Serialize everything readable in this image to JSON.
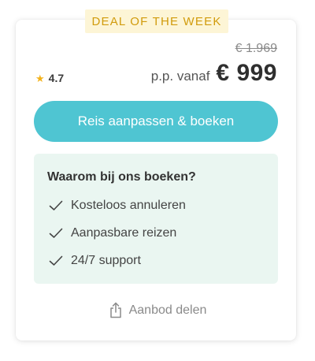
{
  "deal": {
    "badge": "DEAL OF THE WEEK"
  },
  "rating": {
    "value": "4.7",
    "icon": "star-icon"
  },
  "price": {
    "old": "€ 1.969",
    "prefix": "p.p. vanaf",
    "current": "€ 999"
  },
  "cta": {
    "label": "Reis aanpassen & boeken"
  },
  "why": {
    "title": "Waarom bij ons boeken?",
    "benefits": [
      {
        "label": "Kosteloos annuleren"
      },
      {
        "label": "Aanpasbare reizen"
      },
      {
        "label": "24/7 support"
      }
    ]
  },
  "share": {
    "label": "Aanbod delen",
    "icon": "share-icon"
  },
  "colors": {
    "accent": "#4fc5d2",
    "badge_bg": "#fdf5d6",
    "badge_text": "#d19b0c",
    "why_bg": "#eaf6f1",
    "star": "#f3b21b"
  }
}
